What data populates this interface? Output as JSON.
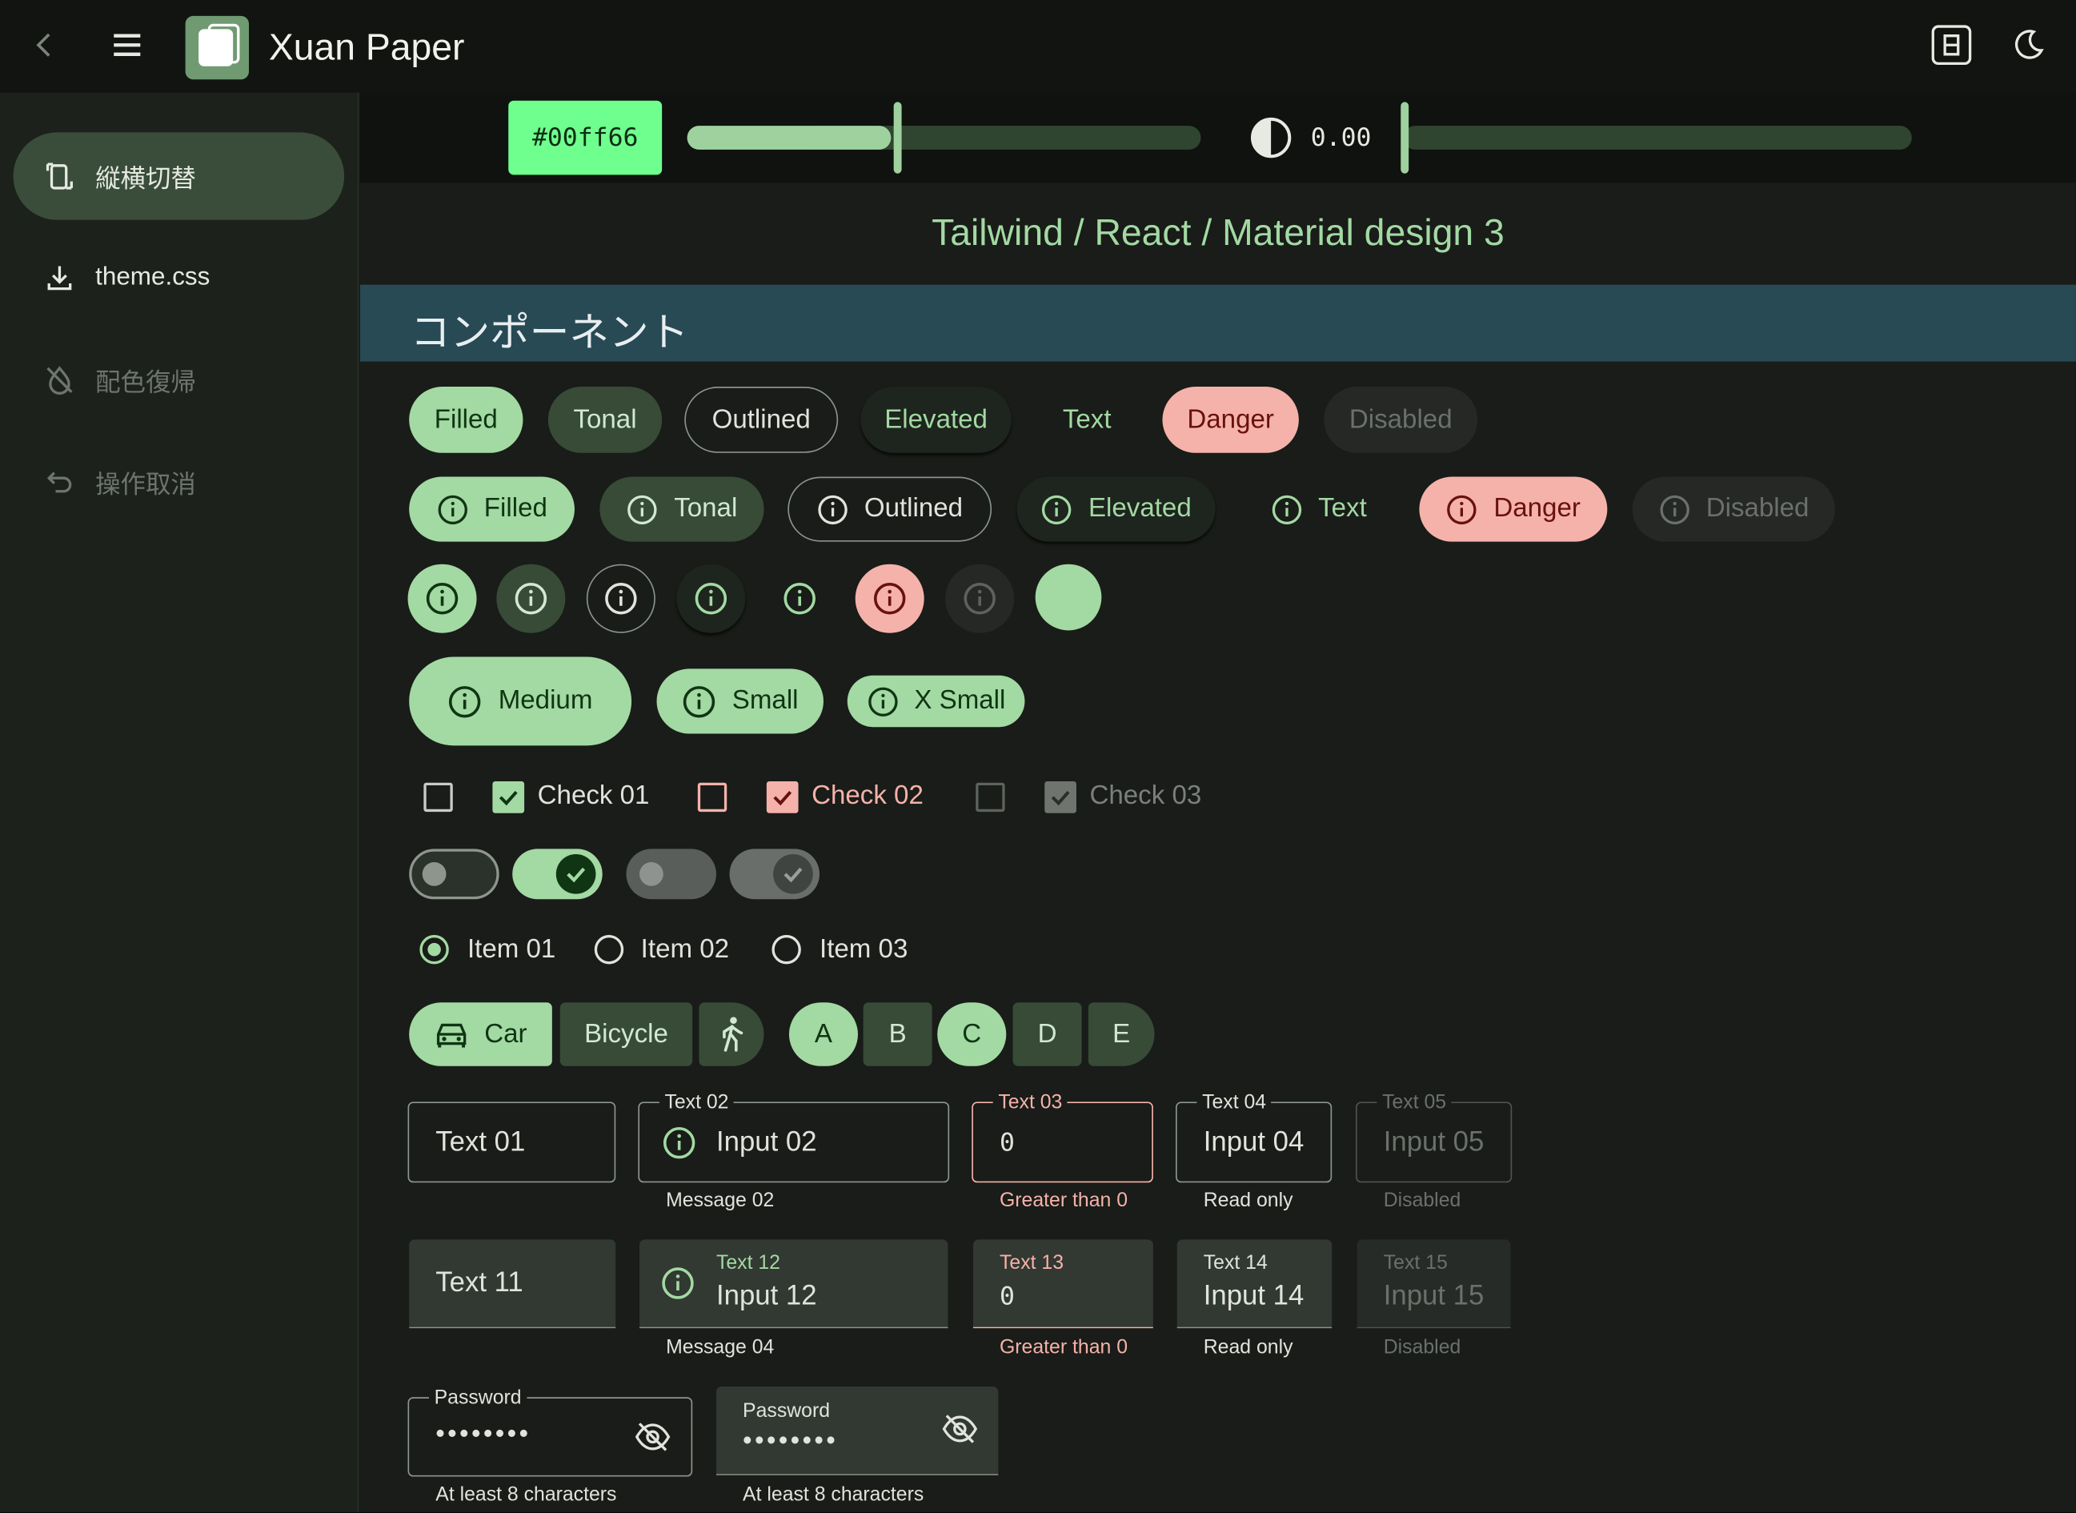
{
  "app": {
    "title": "Xuan Paper"
  },
  "sidebar": {
    "items": [
      {
        "label": "縦横切替",
        "icon": "rotate-device-icon"
      },
      {
        "label": "theme.css",
        "icon": "download-icon"
      },
      {
        "label": "配色復帰",
        "icon": "format-color-reset-icon"
      },
      {
        "label": "操作取消",
        "icon": "undo-icon"
      }
    ]
  },
  "toolbar": {
    "color_hex": "#00ff66",
    "hue_level": 0.41,
    "contrast_value": "0.00",
    "contrast_level": 0.0
  },
  "page": {
    "subtitle": "Tailwind / React / Material design 3",
    "section_title": "コンポーネント"
  },
  "buttons": {
    "row1": [
      "Filled",
      "Tonal",
      "Outlined",
      "Elevated",
      "Text",
      "Danger",
      "Disabled"
    ],
    "row2": [
      "Filled",
      "Tonal",
      "Outlined",
      "Elevated",
      "Text",
      "Danger",
      "Disabled"
    ],
    "sizes": [
      "Medium",
      "Small",
      "X Small"
    ]
  },
  "checkboxes": [
    "Check 01",
    "Check 02",
    "Check 03"
  ],
  "radios": [
    "Item 01",
    "Item 02",
    "Item 03"
  ],
  "segmented": {
    "transport": [
      "Car",
      "Bicycle"
    ],
    "letters": [
      "A",
      "B",
      "C",
      "D",
      "E"
    ]
  },
  "fields_outlined": [
    {
      "label": "",
      "value": "Text 01",
      "help": ""
    },
    {
      "label": "Text 02",
      "value": "Input 02",
      "help": "Message 02"
    },
    {
      "label": "Text 03",
      "value": "0",
      "help": "Greater than 0"
    },
    {
      "label": "Text 04",
      "value": "Input 04",
      "help": "Read only"
    },
    {
      "label": "Text 05",
      "value": "Input 05",
      "help": "Disabled"
    }
  ],
  "fields_filled": [
    {
      "label": "",
      "value": "Text 11",
      "help": ""
    },
    {
      "label": "Text 12",
      "value": "Input 12",
      "help": "Message 04"
    },
    {
      "label": "Text 13",
      "value": "0",
      "help": "Greater than 0"
    },
    {
      "label": "Text 14",
      "value": "Input 14",
      "help": "Read only"
    },
    {
      "label": "Text 15",
      "value": "Input 15",
      "help": "Disabled"
    }
  ],
  "password": [
    {
      "label": "Password",
      "value": "••••••••",
      "help": "At least 8 characters"
    },
    {
      "label": "Password",
      "value": "••••••••",
      "help": "At least 8 characters"
    }
  ],
  "colors": {
    "primary": "#a3d9a3",
    "error": "#f5b2aa",
    "section": "#274a55",
    "background": "#191c18"
  }
}
